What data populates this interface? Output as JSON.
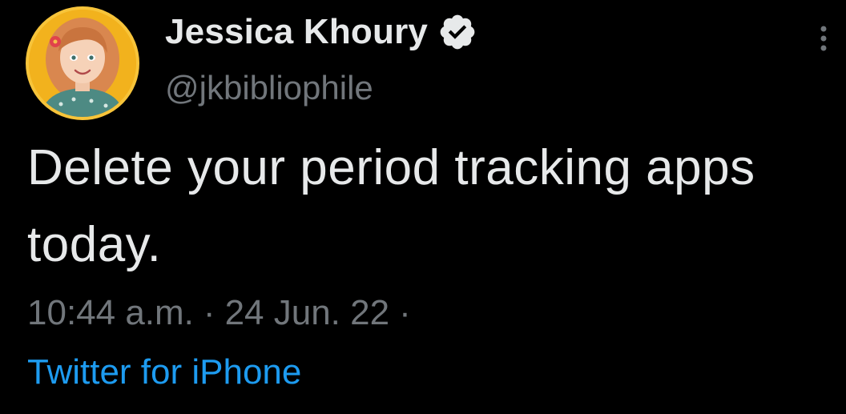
{
  "user": {
    "display_name": "Jessica Khoury",
    "handle": "@jkbibliophile",
    "verified_icon": "verified-badge-icon",
    "avatar": "profile-photo"
  },
  "tweet": {
    "text": "Delete your period tracking apps today."
  },
  "meta": {
    "time": "10:44 a.m.",
    "separator": "·",
    "date": "24 Jun. 22",
    "trailing_separator": "·",
    "source": "Twitter for iPhone"
  },
  "menu": {
    "icon": "more-options-icon"
  },
  "colors": {
    "background": "#000000",
    "primary_text": "#e7e9ea",
    "secondary_text": "#71767b",
    "link": "#1d9bf0"
  }
}
